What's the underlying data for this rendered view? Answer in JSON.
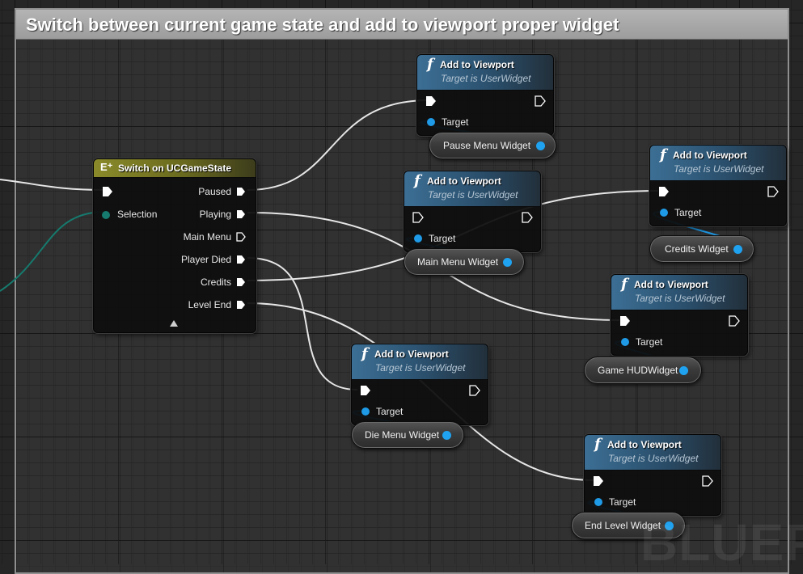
{
  "comment": {
    "title": "Switch between current game state and add to viewport proper widget"
  },
  "switch_node": {
    "icon": "E⁺",
    "title": "Switch on UCGameState",
    "selection_label": "Selection",
    "outputs": [
      "Paused",
      "Playing",
      "Main Menu",
      "Player Died",
      "Credits",
      "Level End"
    ]
  },
  "add_to_viewport_nodes": [
    {
      "title": "Add to Viewport",
      "subtitle": "Target is UserWidget",
      "target_label": "Target"
    },
    {
      "title": "Add to Viewport",
      "subtitle": "Target is UserWidget",
      "target_label": "Target"
    },
    {
      "title": "Add to Viewport",
      "subtitle": "Target is UserWidget",
      "target_label": "Target"
    },
    {
      "title": "Add to Viewport",
      "subtitle": "Target is UserWidget",
      "target_label": "Target"
    },
    {
      "title": "Add to Viewport",
      "subtitle": "Target is UserWidget",
      "target_label": "Target"
    },
    {
      "title": "Add to Viewport",
      "subtitle": "Target is UserWidget",
      "target_label": "Target"
    }
  ],
  "variables": [
    "Pause Menu Widget",
    "Main Menu Widget",
    "Credits Widget",
    "Game HUDWidget",
    "Die Menu Widget",
    "End Level Widget"
  ],
  "watermark": "BLUEPR",
  "colors": {
    "exec_wire": "#e6e6e6",
    "object_wire": "#1f9ae6",
    "enum_wire": "#167a6e",
    "function_header": "#3c6f95",
    "switch_header": "#8a8a2a"
  }
}
